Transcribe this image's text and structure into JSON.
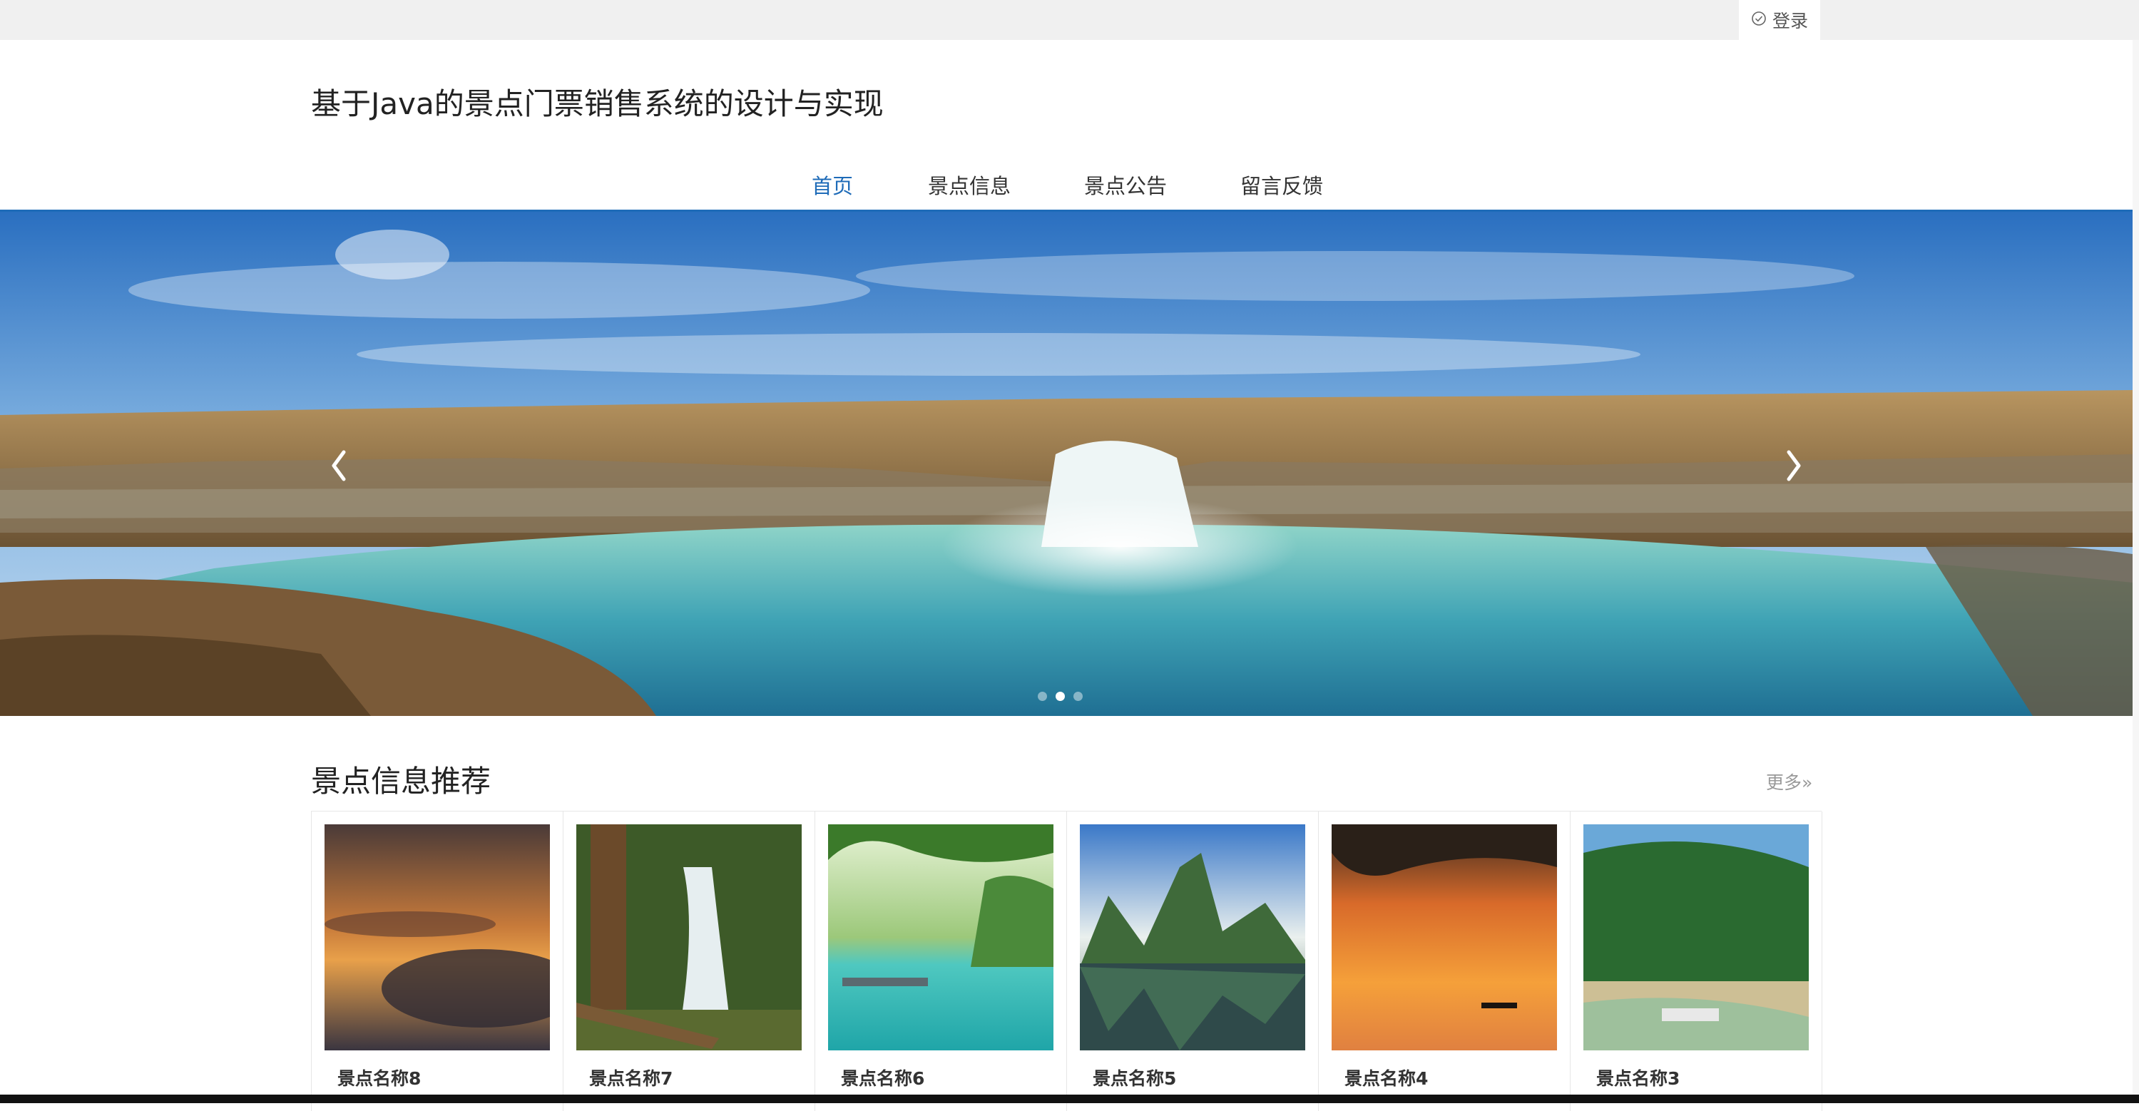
{
  "header": {
    "login_label": "登录",
    "site_title": "基于Java的景点门票销售系统的设计与实现"
  },
  "nav": {
    "items": [
      {
        "label": "首页",
        "active": true
      },
      {
        "label": "景点信息",
        "active": false
      },
      {
        "label": "景点公告",
        "active": false
      },
      {
        "label": "留言反馈",
        "active": false
      }
    ]
  },
  "carousel": {
    "slide_count": 3,
    "active_index": 1,
    "icons": {
      "prev": "chevron-left-icon",
      "next": "chevron-right-icon"
    }
  },
  "recommend": {
    "title": "景点信息推荐",
    "more_label": "更多»",
    "items": [
      {
        "name": "景点名称8"
      },
      {
        "name": "景点名称7"
      },
      {
        "name": "景点名称6"
      },
      {
        "name": "景点名称5"
      },
      {
        "name": "景点名称4"
      },
      {
        "name": "景点名称3"
      }
    ]
  },
  "colors": {
    "accent": "#1e6bb8",
    "topbar": "#f0f0f0"
  }
}
